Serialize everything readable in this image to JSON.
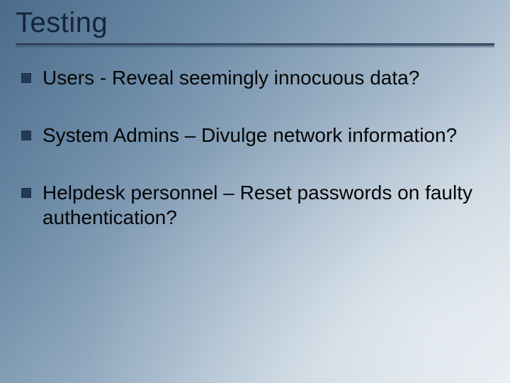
{
  "slide": {
    "title": "Testing",
    "bullets": [
      {
        "text": "Users - Reveal seemingly innocuous data?"
      },
      {
        "text": "System Admins – Divulge network information?"
      },
      {
        "text": "Helpdesk personnel – Reset passwords on faulty authentication?"
      }
    ]
  }
}
